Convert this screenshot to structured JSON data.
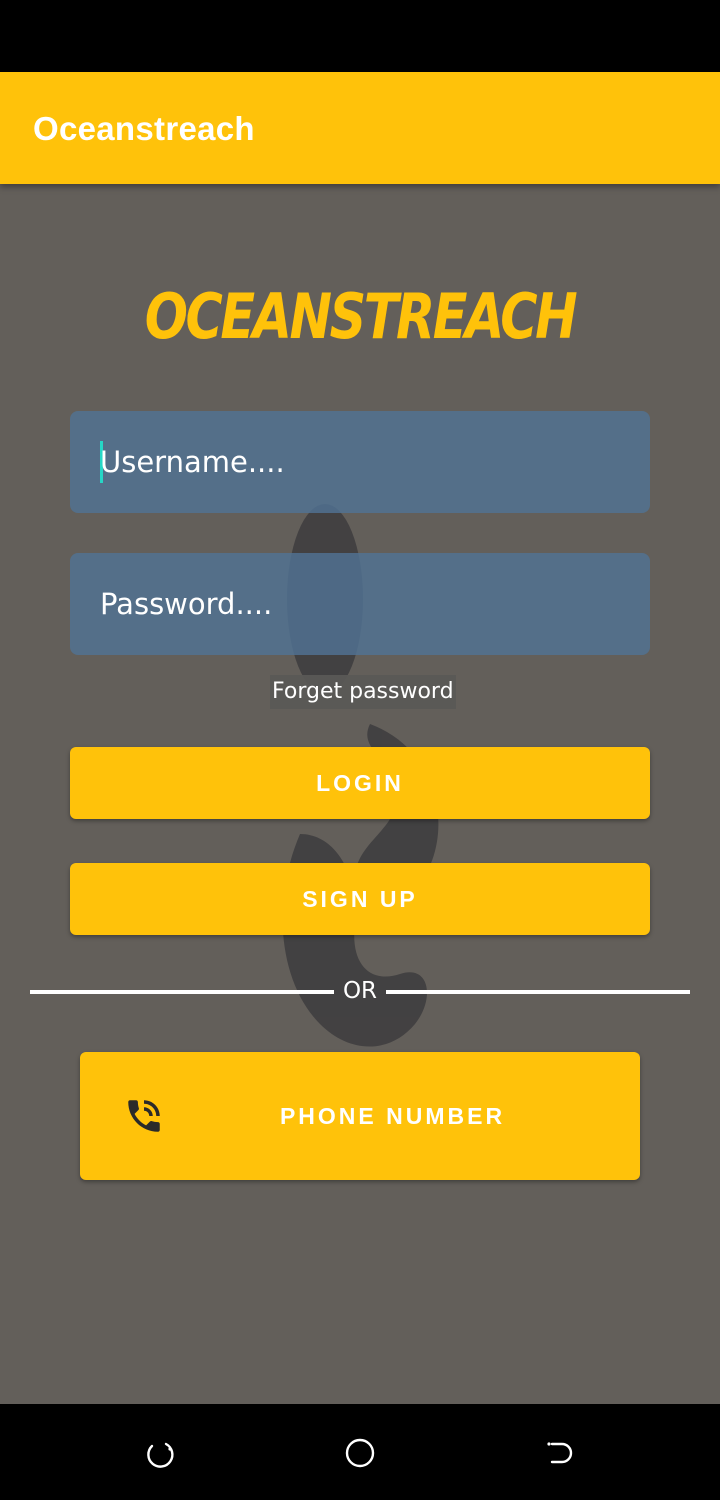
{
  "app_bar": {
    "title": "Oceanstreach"
  },
  "logo": {
    "text": "OCEANSTREACH"
  },
  "form": {
    "username_placeholder": "Username....",
    "password_placeholder": "Password....",
    "forget_password": "Forget password",
    "login_label": "LOGIN",
    "signup_label": "SIGN UP",
    "divider_text": "OR",
    "phone_label": "PHONE NUMBER",
    "phone_icon": "phone-call-icon"
  },
  "nav": {
    "icons": [
      "recents-icon",
      "home-icon",
      "back-icon"
    ]
  },
  "colors": {
    "accent": "#FFC20A",
    "background": "#635f5a",
    "field": "#50738f"
  }
}
